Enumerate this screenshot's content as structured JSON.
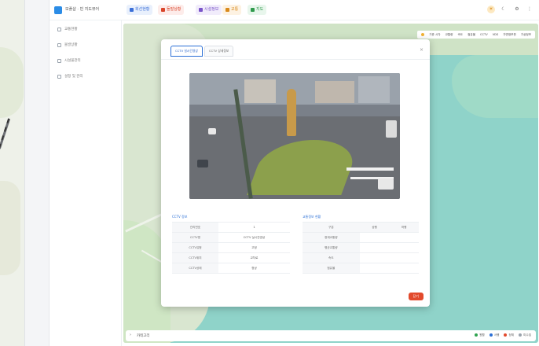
{
  "app": {
    "title": "모플샵 · 빈 지도뷰어"
  },
  "toolbar": {
    "buttons": [
      {
        "label": "회선현황",
        "color": "#3b6fd8",
        "bg": "#e9f0fc"
      },
      {
        "label": "돌발상황",
        "color": "#d9452a",
        "bg": "#fdecea"
      },
      {
        "label": "시설정보",
        "color": "#7a55c9",
        "bg": "#f1ecfb"
      },
      {
        "label": "교통",
        "color": "#d98a1c",
        "bg": "#fdf2e2"
      },
      {
        "label": "지도",
        "color": "#2f9a4c",
        "bg": "#e8f6ec"
      }
    ],
    "right_icons": [
      "sun-icon",
      "moon-icon",
      "gear-icon",
      "menu-icon"
    ]
  },
  "sidebar": {
    "items": [
      {
        "label": "교통현황",
        "icon": "traffic-icon"
      },
      {
        "label": "돌발상황",
        "icon": "alert-icon"
      },
      {
        "label": "시설물관리",
        "icon": "facility-icon"
      },
      {
        "label": "설정 및 관리",
        "icon": "settings-icon"
      }
    ]
  },
  "map": {
    "chips": [
      "기준 시각",
      "교통량",
      "속도",
      "점유율",
      "CCTV",
      "VDS",
      "가변정보판",
      "기상정보"
    ],
    "bottom_label": "카테고리",
    "legend": [
      {
        "label": "원활",
        "color": "#2fa34f"
      },
      {
        "label": "서행",
        "color": "#2b6fd6"
      },
      {
        "label": "정체",
        "color": "#e24a2c"
      },
      {
        "label": "미수집",
        "color": "#9aa3ad"
      }
    ]
  },
  "modal": {
    "tabs": [
      "CCTV 실시간영상",
      "CCTV 상세정보"
    ],
    "active_tab": 0,
    "cctv_section_title": "CCTV 정보",
    "cctv_rows": [
      {
        "label": "관리번호",
        "value": "1"
      },
      {
        "label": "CCTV명",
        "value": "CCTV 실시간영상"
      },
      {
        "label": "CCTV유형",
        "value": "고정"
      },
      {
        "label": "CCTV위치",
        "value": "교차로"
      },
      {
        "label": "CCTV상태",
        "value": "정상"
      }
    ],
    "traffic_section_title": "교통정보 현황",
    "traffic_headers": [
      "구분",
      "상행",
      "하행"
    ],
    "traffic_rows": [
      {
        "label": "현재교통량",
        "up": "",
        "down": ""
      },
      {
        "label": "평균교통량",
        "up": "",
        "down": ""
      },
      {
        "label": "속도",
        "up": "",
        "down": ""
      },
      {
        "label": "점유율",
        "up": "",
        "down": ""
      }
    ],
    "close_label": "닫기"
  }
}
